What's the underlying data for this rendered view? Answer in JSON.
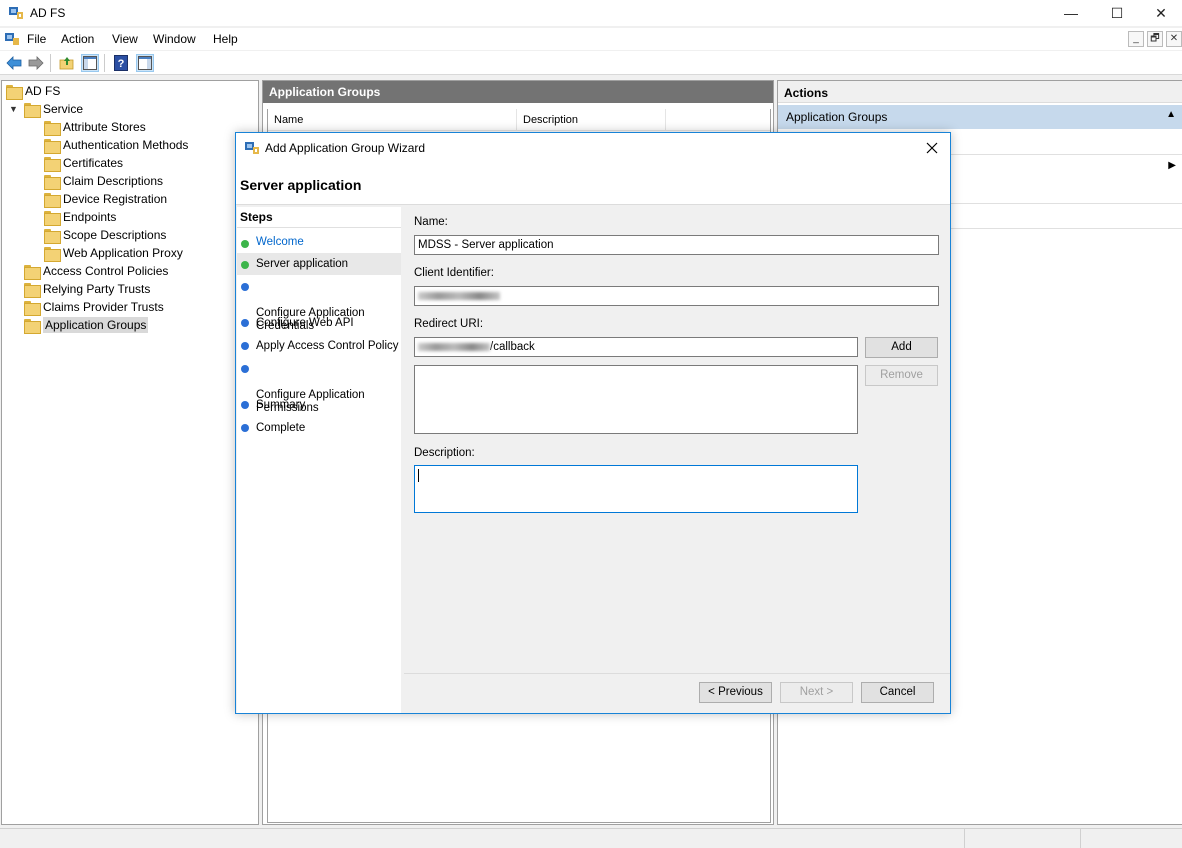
{
  "window": {
    "title": "AD FS",
    "min_glyph": "—",
    "max_glyph": "☐",
    "close_glyph": "✕"
  },
  "menu": {
    "items": [
      "File",
      "Action",
      "View",
      "Window",
      "Help"
    ],
    "mdi_min": "_",
    "mdi_restore": "🗗",
    "mdi_close": "✕"
  },
  "tree": {
    "root": "AD FS",
    "service": "Service",
    "service_children": [
      "Attribute Stores",
      "Authentication Methods",
      "Certificates",
      "Claim Descriptions",
      "Device Registration",
      "Endpoints",
      "Scope Descriptions",
      "Web Application Proxy"
    ],
    "top_items": [
      "Access Control Policies",
      "Relying Party Trusts",
      "Claims Provider Trusts",
      "Application Groups"
    ],
    "selected": "Application Groups"
  },
  "center": {
    "header": "Application Groups",
    "columns": [
      "Name",
      "Description"
    ]
  },
  "actions": {
    "header": "Actions",
    "section": "Application Groups"
  },
  "wizard": {
    "title": "Add Application Group Wizard",
    "page_title": "Server application",
    "steps_header": "Steps",
    "steps": [
      {
        "label": "Welcome",
        "state": "done"
      },
      {
        "label": "Server application",
        "state": "current"
      },
      {
        "label": "Configure Application\nCredentials",
        "state": "pending"
      },
      {
        "label": "Configure Web API",
        "state": "pending"
      },
      {
        "label": "Apply Access Control Policy",
        "state": "pending"
      },
      {
        "label": "Configure Application\nPermissions",
        "state": "pending"
      },
      {
        "label": "Summary",
        "state": "pending"
      },
      {
        "label": "Complete",
        "state": "pending"
      }
    ],
    "name_label": "Name:",
    "name_value": "MDSS - Server application",
    "client_id_label": "Client Identifier:",
    "redirect_label": "Redirect URI:",
    "redirect_value_suffix": "/callback",
    "add_button": "Add",
    "remove_button": "Remove",
    "description_label": "Description:",
    "description_value": "",
    "prev_button": "< Previous",
    "next_button": "Next >",
    "cancel_button": "Cancel"
  },
  "colors": {
    "step_done": "#3cb54a",
    "step_pending": "#2b6fd6",
    "dialog_border": "#1883d7",
    "center_header": "#737373",
    "actions_section": "#c6d9ec"
  }
}
